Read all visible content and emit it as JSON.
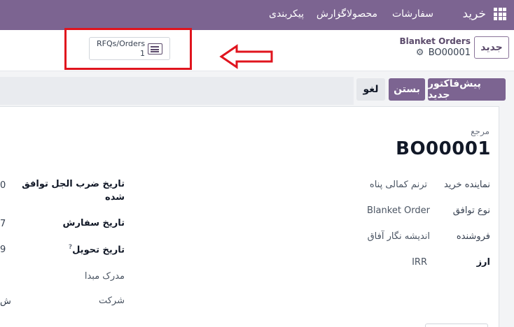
{
  "navbar": {
    "app_name": "خرید",
    "menu": [
      "سفارشات",
      "محصولات",
      "گزارش",
      "پیکربندی"
    ]
  },
  "control": {
    "new_button": "جدید",
    "breadcrumb_parent": "Blanket Orders",
    "breadcrumb_current": "BO00001",
    "smart_button": {
      "label": "RFQs/Orders",
      "count": "1"
    }
  },
  "statusbar": {
    "buttons": [
      "پیش‌فاکتور جدید",
      "بستن",
      "لغو"
    ]
  },
  "form": {
    "reference_label": "مرجع",
    "reference": "BO00001",
    "right_fields": [
      {
        "label": "نماینده خرید",
        "value": "ترنم کمالی پناه"
      },
      {
        "label": "نوع توافق",
        "value": "Blanket Order"
      },
      {
        "label": "فروشنده",
        "value": "اندیشه نگار آفاق"
      },
      {
        "label": "ارز",
        "value": "IRR"
      }
    ],
    "left_fields": [
      {
        "label_line1": "تاریخ ضرب الجل توافق",
        "label_line2": "شده",
        "value_partial": "0"
      },
      {
        "label": "تاریخ سفارش",
        "value_partial": "7"
      },
      {
        "label": "تاریخ تحویل",
        "help": "?",
        "value_partial": "9"
      },
      {
        "label": "مدرک مبدا",
        "value_partial": ""
      },
      {
        "label": "شرکت",
        "value_partial": "ش"
      }
    ]
  },
  "colors": {
    "navbar": "#7c6491",
    "primary": "#7c6491",
    "annotation": "#e0141e"
  }
}
